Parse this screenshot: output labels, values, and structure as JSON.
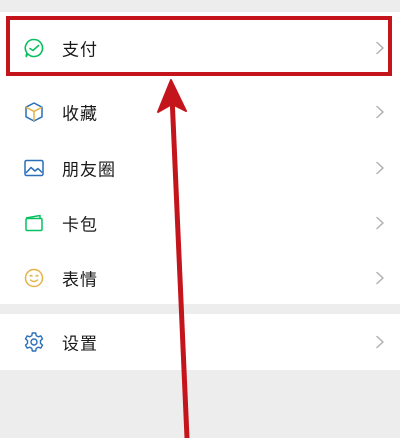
{
  "menu": {
    "items": [
      {
        "label": "支付",
        "icon": "payment-icon"
      },
      {
        "label": "收藏",
        "icon": "favorites-icon"
      },
      {
        "label": "朋友圈",
        "icon": "moments-icon"
      },
      {
        "label": "卡包",
        "icon": "card-wallet-icon"
      },
      {
        "label": "表情",
        "icon": "sticker-emoji-icon"
      }
    ],
    "settings": {
      "label": "设置",
      "icon": "settings-gear-icon"
    }
  },
  "colors": {
    "highlight": "#c4151c",
    "wechat_green": "#07c160",
    "icon_blue": "#2a6fb8",
    "icon_gold": "#e2b447"
  }
}
